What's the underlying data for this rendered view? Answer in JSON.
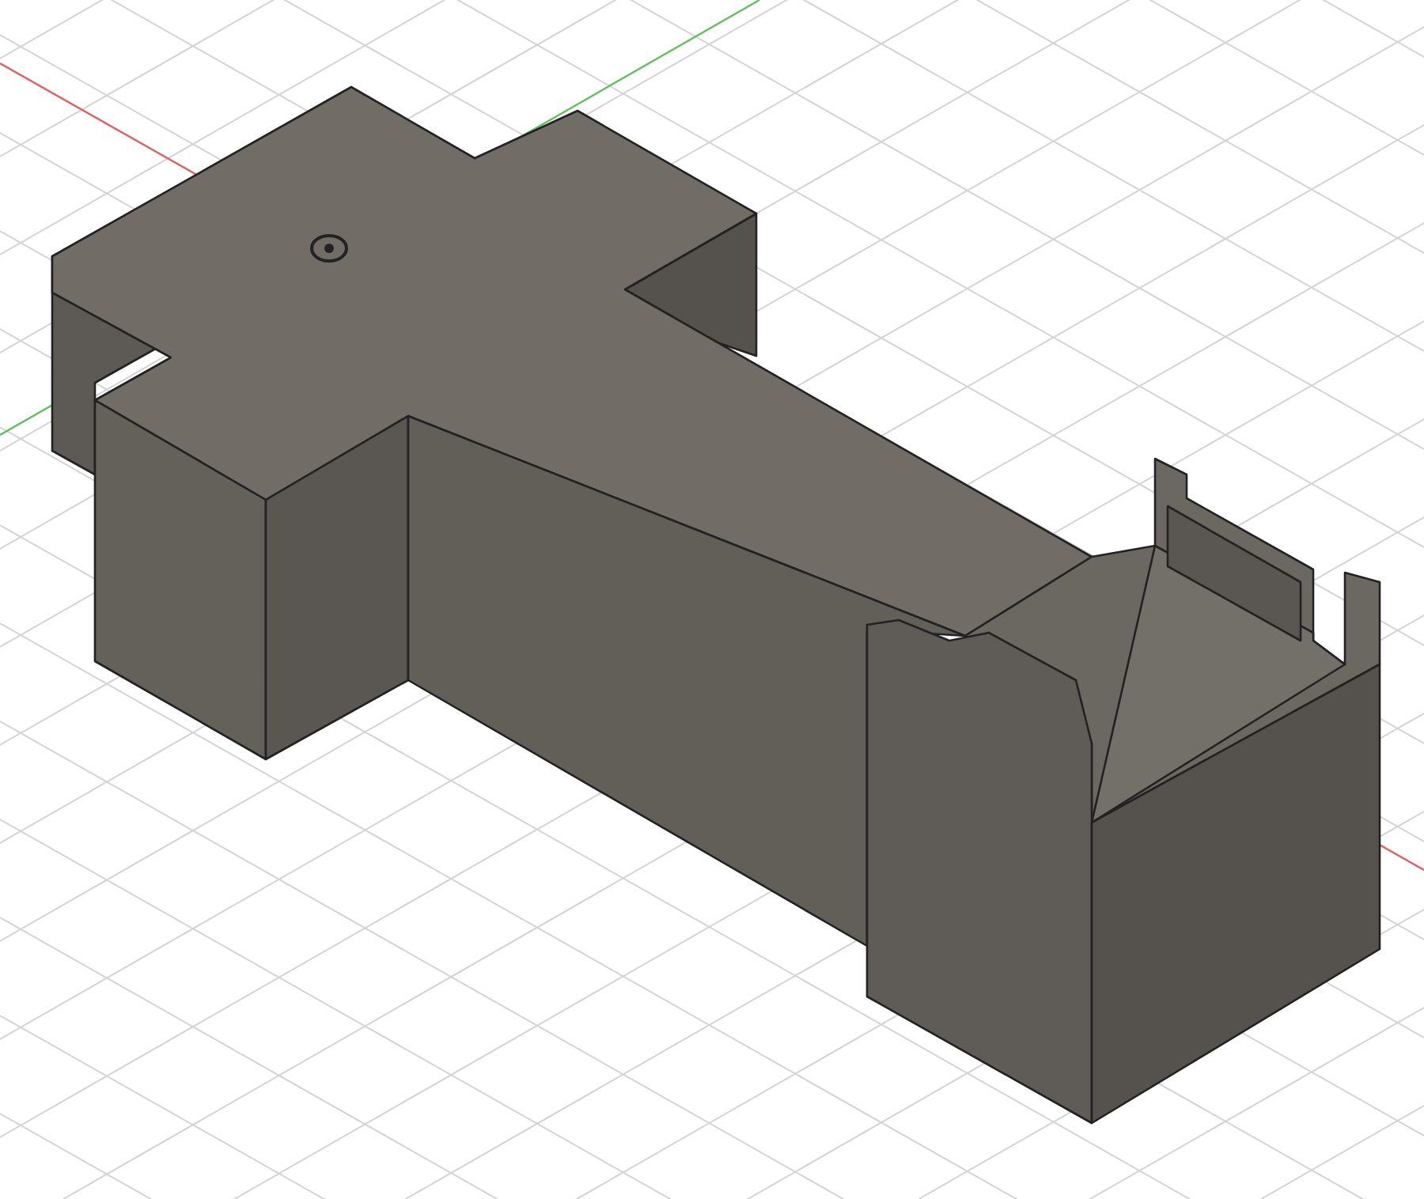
{
  "viewport": {
    "grid_visible": true,
    "axes_visible": true,
    "origin_marker_visible": true
  }
}
